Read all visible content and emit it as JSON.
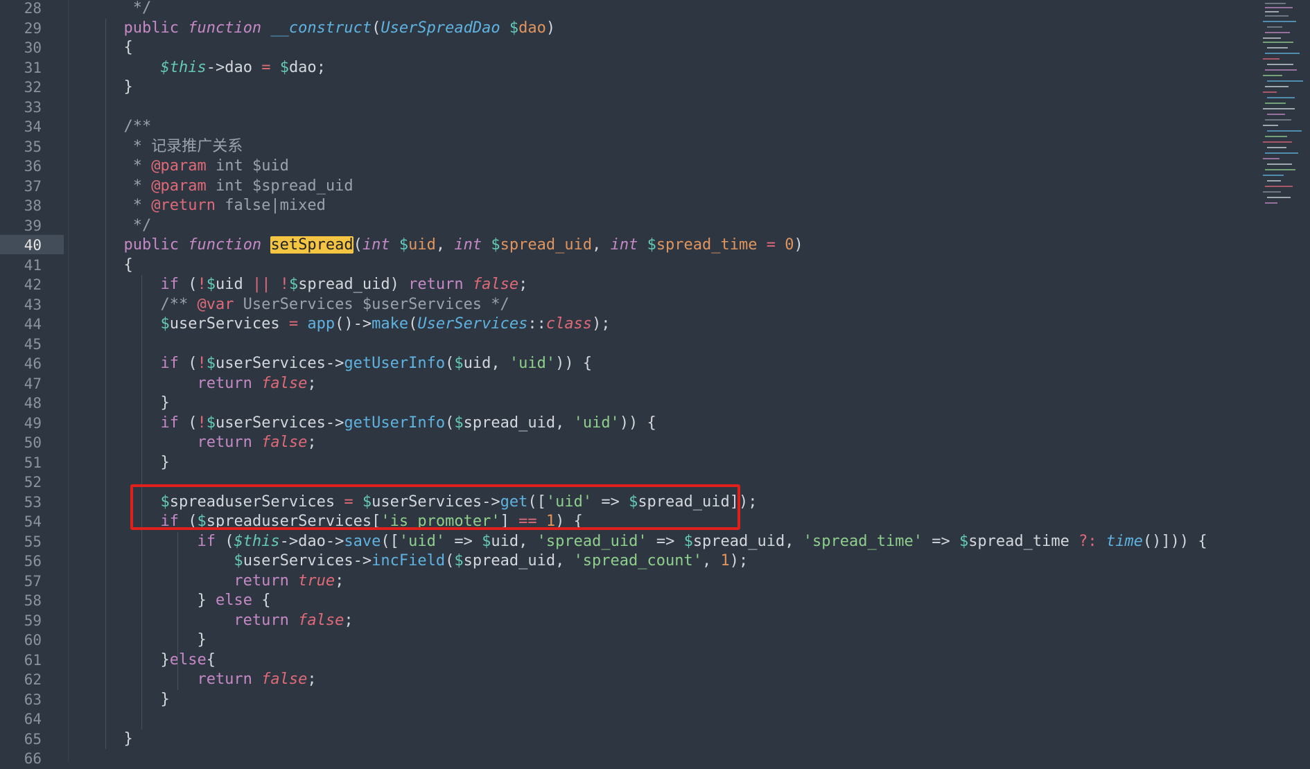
{
  "editor": {
    "active_line": 40,
    "lines": [
      {
        "n": "28",
        "segs": [
          [
            "cmt",
            "   */"
          ]
        ]
      },
      {
        "n": "29",
        "segs": [
          [
            "kw",
            "  public "
          ],
          [
            "kwi",
            "function "
          ],
          [
            "type",
            "__construct"
          ],
          [
            "punc",
            "("
          ],
          [
            "type",
            "UserSpreadDao "
          ],
          [
            "dollar",
            "$"
          ],
          [
            "num",
            "dao"
          ],
          [
            "punc",
            ")"
          ]
        ]
      },
      {
        "n": "30",
        "segs": [
          [
            "punc",
            "  {"
          ]
        ]
      },
      {
        "n": "31",
        "segs": [
          [
            "this",
            "      $this"
          ],
          [
            "punc",
            "->"
          ],
          [
            "var",
            "dao "
          ],
          [
            "op",
            "= "
          ],
          [
            "dollar",
            "$"
          ],
          [
            "var",
            "dao"
          ],
          [
            "punc",
            ";"
          ]
        ]
      },
      {
        "n": "32",
        "segs": [
          [
            "punc",
            "  }"
          ]
        ]
      },
      {
        "n": "33",
        "segs": []
      },
      {
        "n": "34",
        "segs": [
          [
            "cmt",
            "  /**"
          ]
        ]
      },
      {
        "n": "35",
        "segs": [
          [
            "cmt",
            "   * 记录推广关系"
          ]
        ]
      },
      {
        "n": "36",
        "segs": [
          [
            "cmt",
            "   * "
          ],
          [
            "tag",
            "@param"
          ],
          [
            "cmt",
            " int $uid"
          ]
        ]
      },
      {
        "n": "37",
        "segs": [
          [
            "cmt",
            "   * "
          ],
          [
            "tag",
            "@param"
          ],
          [
            "cmt",
            " int $spread_uid"
          ]
        ]
      },
      {
        "n": "38",
        "segs": [
          [
            "cmt",
            "   * "
          ],
          [
            "tag",
            "@return"
          ],
          [
            "cmt",
            " false|mixed"
          ]
        ]
      },
      {
        "n": "39",
        "segs": [
          [
            "cmt",
            "   */"
          ]
        ]
      },
      {
        "n": "40",
        "segs": [
          [
            "kw",
            "  public "
          ],
          [
            "kwi",
            "function "
          ],
          [
            "hl",
            "setSpread"
          ],
          [
            "punc",
            "("
          ],
          [
            "kwi",
            "int "
          ],
          [
            "dollar",
            "$"
          ],
          [
            "num",
            "uid"
          ],
          [
            "punc",
            ", "
          ],
          [
            "kwi",
            "int "
          ],
          [
            "dollar",
            "$"
          ],
          [
            "num",
            "spread_uid"
          ],
          [
            "punc",
            ", "
          ],
          [
            "kwi",
            "int "
          ],
          [
            "dollar",
            "$"
          ],
          [
            "num",
            "spread_time "
          ],
          [
            "op",
            "= "
          ],
          [
            "num",
            "0"
          ],
          [
            "punc",
            ")"
          ]
        ]
      },
      {
        "n": "41",
        "segs": [
          [
            "punc",
            "  {"
          ]
        ]
      },
      {
        "n": "42",
        "segs": [
          [
            "kw",
            "      if "
          ],
          [
            "punc",
            "("
          ],
          [
            "op",
            "!"
          ],
          [
            "dollar",
            "$"
          ],
          [
            "var",
            "uid "
          ],
          [
            "op",
            "|| !"
          ],
          [
            "dollar",
            "$"
          ],
          [
            "var",
            "spread_uid"
          ],
          [
            "punc",
            ") "
          ],
          [
            "kw",
            "return "
          ],
          [
            "bool",
            "false"
          ],
          [
            "punc",
            ";"
          ]
        ]
      },
      {
        "n": "43",
        "segs": [
          [
            "cmt",
            "      /** "
          ],
          [
            "tag",
            "@var"
          ],
          [
            "cmt",
            " UserServices $userServices */"
          ]
        ]
      },
      {
        "n": "44",
        "segs": [
          [
            "dollar",
            "      $"
          ],
          [
            "var",
            "userServices "
          ],
          [
            "op",
            "= "
          ],
          [
            "fn",
            "app"
          ],
          [
            "punc",
            "()->"
          ],
          [
            "fn",
            "make"
          ],
          [
            "punc",
            "("
          ],
          [
            "type",
            "UserServices"
          ],
          [
            "punc",
            "::"
          ],
          [
            "bool",
            "class"
          ],
          [
            "punc",
            ");"
          ]
        ]
      },
      {
        "n": "45",
        "segs": []
      },
      {
        "n": "46",
        "segs": [
          [
            "kw",
            "      if "
          ],
          [
            "punc",
            "("
          ],
          [
            "op",
            "!"
          ],
          [
            "dollar",
            "$"
          ],
          [
            "var",
            "userServices"
          ],
          [
            "punc",
            "->"
          ],
          [
            "fn",
            "getUserInfo"
          ],
          [
            "punc",
            "("
          ],
          [
            "dollar",
            "$"
          ],
          [
            "var",
            "uid"
          ],
          [
            "punc",
            ", "
          ],
          [
            "str",
            "'uid'"
          ],
          [
            "punc",
            ")) {"
          ]
        ]
      },
      {
        "n": "47",
        "segs": [
          [
            "kw",
            "          return "
          ],
          [
            "bool",
            "false"
          ],
          [
            "punc",
            ";"
          ]
        ]
      },
      {
        "n": "48",
        "segs": [
          [
            "punc",
            "      }"
          ]
        ]
      },
      {
        "n": "49",
        "segs": [
          [
            "kw",
            "      if "
          ],
          [
            "punc",
            "("
          ],
          [
            "op",
            "!"
          ],
          [
            "dollar",
            "$"
          ],
          [
            "var",
            "userServices"
          ],
          [
            "punc",
            "->"
          ],
          [
            "fn",
            "getUserInfo"
          ],
          [
            "punc",
            "("
          ],
          [
            "dollar",
            "$"
          ],
          [
            "var",
            "spread_uid"
          ],
          [
            "punc",
            ", "
          ],
          [
            "str",
            "'uid'"
          ],
          [
            "punc",
            ")) {"
          ]
        ]
      },
      {
        "n": "50",
        "segs": [
          [
            "kw",
            "          return "
          ],
          [
            "bool",
            "false"
          ],
          [
            "punc",
            ";"
          ]
        ]
      },
      {
        "n": "51",
        "segs": [
          [
            "punc",
            "      }"
          ]
        ]
      },
      {
        "n": "52",
        "segs": []
      },
      {
        "n": "53",
        "segs": [
          [
            "dollar",
            "      $"
          ],
          [
            "var",
            "spreaduserServices "
          ],
          [
            "op",
            "= "
          ],
          [
            "dollar",
            "$"
          ],
          [
            "var",
            "userServices"
          ],
          [
            "punc",
            "->"
          ],
          [
            "fn",
            "get"
          ],
          [
            "punc",
            "(["
          ],
          [
            "str",
            "'uid'"
          ],
          [
            "punc",
            " => "
          ],
          [
            "dollar",
            "$"
          ],
          [
            "var",
            "spread_uid"
          ],
          [
            "punc",
            "]);"
          ]
        ]
      },
      {
        "n": "54",
        "segs": [
          [
            "kw",
            "      if "
          ],
          [
            "punc",
            "("
          ],
          [
            "dollar",
            "$"
          ],
          [
            "var",
            "spreaduserServices"
          ],
          [
            "punc",
            "["
          ],
          [
            "str",
            "'is_promoter'"
          ],
          [
            "punc",
            "] "
          ],
          [
            "op",
            "== "
          ],
          [
            "num",
            "1"
          ],
          [
            "punc",
            ") {"
          ]
        ]
      },
      {
        "n": "55",
        "segs": [
          [
            "kw",
            "          if "
          ],
          [
            "punc",
            "("
          ],
          [
            "this",
            "$this"
          ],
          [
            "punc",
            "->"
          ],
          [
            "var",
            "dao"
          ],
          [
            "punc",
            "->"
          ],
          [
            "fn",
            "save"
          ],
          [
            "punc",
            "(["
          ],
          [
            "str",
            "'uid'"
          ],
          [
            "punc",
            " => "
          ],
          [
            "dollar",
            "$"
          ],
          [
            "var",
            "uid"
          ],
          [
            "punc",
            ", "
          ],
          [
            "str",
            "'spread_uid'"
          ],
          [
            "punc",
            " => "
          ],
          [
            "dollar",
            "$"
          ],
          [
            "var",
            "spread_uid"
          ],
          [
            "punc",
            ", "
          ],
          [
            "str",
            "'spread_time'"
          ],
          [
            "punc",
            " => "
          ],
          [
            "dollar",
            "$"
          ],
          [
            "var",
            "spread_time "
          ],
          [
            "op",
            "?: "
          ],
          [
            "type",
            "time"
          ],
          [
            "punc",
            "()])) {"
          ]
        ]
      },
      {
        "n": "56",
        "segs": [
          [
            "dollar",
            "              $"
          ],
          [
            "var",
            "userServices"
          ],
          [
            "punc",
            "->"
          ],
          [
            "fn",
            "incField"
          ],
          [
            "punc",
            "("
          ],
          [
            "dollar",
            "$"
          ],
          [
            "var",
            "spread_uid"
          ],
          [
            "punc",
            ", "
          ],
          [
            "str",
            "'spread_count'"
          ],
          [
            "punc",
            ", "
          ],
          [
            "num",
            "1"
          ],
          [
            "punc",
            ");"
          ]
        ]
      },
      {
        "n": "57",
        "segs": [
          [
            "kw",
            "              return "
          ],
          [
            "bool",
            "true"
          ],
          [
            "punc",
            ";"
          ]
        ]
      },
      {
        "n": "58",
        "segs": [
          [
            "punc",
            "          } "
          ],
          [
            "kw",
            "else "
          ],
          [
            "punc",
            "{"
          ]
        ]
      },
      {
        "n": "59",
        "segs": [
          [
            "kw",
            "              return "
          ],
          [
            "bool",
            "false"
          ],
          [
            "punc",
            ";"
          ]
        ]
      },
      {
        "n": "60",
        "segs": [
          [
            "punc",
            "          }"
          ]
        ]
      },
      {
        "n": "61",
        "segs": [
          [
            "punc",
            "      }"
          ],
          [
            "kw",
            "else"
          ],
          [
            "punc",
            "{"
          ]
        ]
      },
      {
        "n": "62",
        "segs": [
          [
            "kw",
            "          return "
          ],
          [
            "bool",
            "false"
          ],
          [
            "punc",
            ";"
          ]
        ]
      },
      {
        "n": "63",
        "segs": [
          [
            "punc",
            "      }"
          ]
        ]
      },
      {
        "n": "64",
        "segs": []
      },
      {
        "n": "65",
        "segs": [
          [
            "punc",
            "  }"
          ]
        ]
      },
      {
        "n": "66",
        "segs": []
      }
    ]
  },
  "colors": {
    "background": "#2e3641",
    "highlight_box": "#e0201a",
    "selection": "#f4c542"
  }
}
